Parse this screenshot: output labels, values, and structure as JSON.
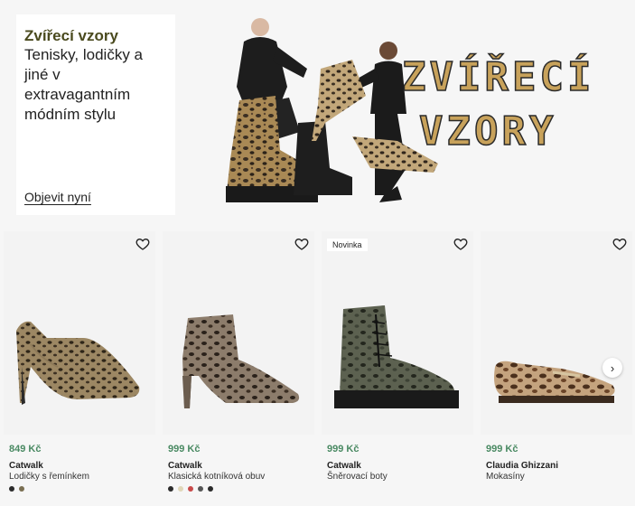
{
  "hero": {
    "title": "Zvířecí vzory",
    "subtitle": "Tenisky, lodičky a jiné v extravagantním módním stylu",
    "cta": "Objevit nyní",
    "art_line1": "ZVÍŘECÍ",
    "art_line2": "VZORY"
  },
  "products": [
    {
      "price": "849 Kč",
      "brand": "Catwalk",
      "name": "Lodičky s řemínkem",
      "badge": "",
      "swatches": [
        "#2b2b2b",
        "#7a6f52"
      ]
    },
    {
      "price": "999 Kč",
      "brand": "Catwalk",
      "name": "Klasická kotníková obuv",
      "badge": "",
      "swatches": [
        "#2b2b2b",
        "#e0d7b8",
        "#c84a4a",
        "#555555",
        "#2b2b2b"
      ]
    },
    {
      "price": "999 Kč",
      "brand": "Catwalk",
      "name": "Šněrovací boty",
      "badge": "Novinka",
      "swatches": []
    },
    {
      "price": "999 Kč",
      "brand": "Claudia Ghizzani",
      "name": "Mokasíny",
      "badge": "",
      "swatches": []
    }
  ],
  "icons": {
    "favorite": "heart-icon",
    "next": "chevron-right-icon"
  },
  "colors": {
    "price": "#4a8a63",
    "hero_title": "#4a4a1e"
  }
}
